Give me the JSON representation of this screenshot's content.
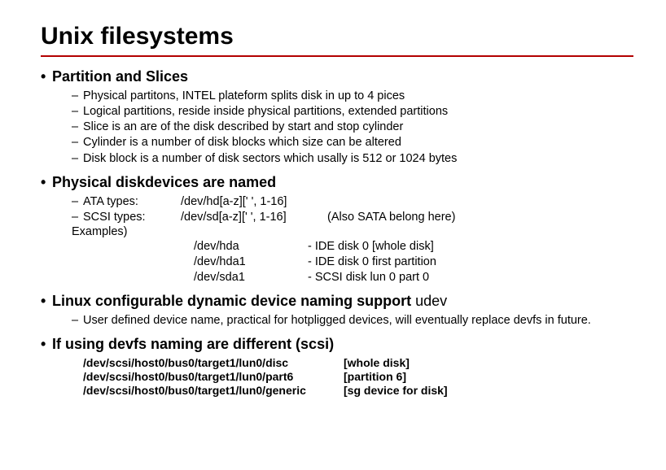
{
  "title": "Unix filesystems",
  "sections": [
    {
      "heading": "Partition and Slices",
      "items": [
        "Physical partitons, INTEL plateform splits disk in up to 4 pices",
        "Logical partitions, reside inside physical partitions, extended partitions",
        "Slice is an are of the disk described by start and stop cylinder",
        "Cylinder is a number of disk blocks which size can be altered",
        "Disk block is a number of disk sectors which usally is 512 or 1024 bytes"
      ]
    },
    {
      "heading": "Physical diskdevices are named",
      "type_rows": [
        {
          "label": "ATA types:",
          "pattern": "/dev/hd[a-z][' ', 1-16]",
          "note": ""
        },
        {
          "label": "SCSI types:",
          "pattern": "/dev/sd[a-z][' ', 1-16]",
          "note": "(Also SATA belong here)"
        }
      ],
      "examples_label": "Examples)",
      "example_rows": [
        {
          "dev": "/dev/hda",
          "desc": "- IDE disk 0 [whole disk]"
        },
        {
          "dev": "/dev/hda1",
          "desc": "- IDE disk 0 first partition"
        },
        {
          "dev": "/dev/sda1",
          "desc": "- SCSI disk lun 0 part 0"
        }
      ]
    },
    {
      "heading_prefix": "Linux configurable dynamic device naming support ",
      "heading_suffix": "udev",
      "items": [
        "User defined device name, practical for hotpligged devices, will eventually replace devfs in future."
      ]
    },
    {
      "heading": "If using devfs naming are different (scsi)",
      "devfs_rows": [
        {
          "path": "/dev/scsi/host0/bus0/target1/lun0/disc",
          "desc": "[whole disk]"
        },
        {
          "path": "/dev/scsi/host0/bus0/target1/lun0/part6",
          "desc": "[partition 6]"
        },
        {
          "path": "/dev/scsi/host0/bus0/target1/lun0/generic",
          "desc": "[sg device for disk]"
        }
      ]
    }
  ]
}
